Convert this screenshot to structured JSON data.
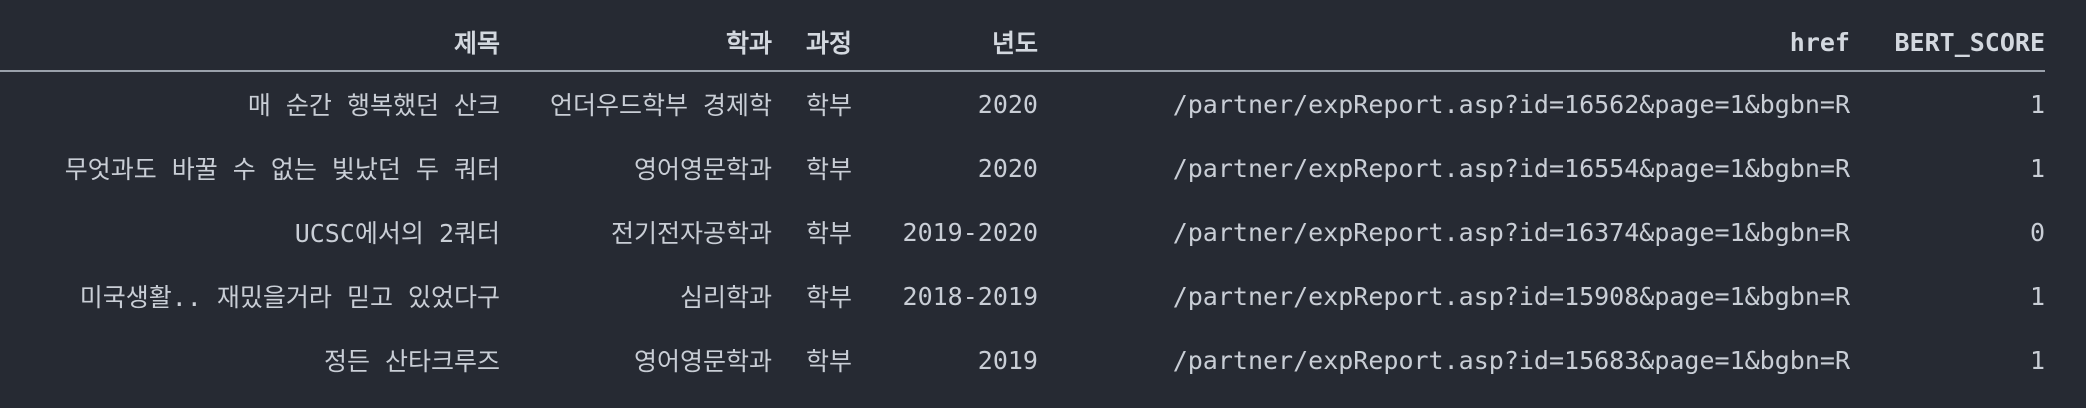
{
  "table": {
    "columns": [
      "제목",
      "학과",
      "과정",
      "년도",
      "href",
      "BERT_SCORE"
    ],
    "rows": [
      [
        "매 순간 행복했던 산크",
        "언더우드학부 경제학",
        "학부",
        "2020",
        "/partner/expReport.asp?id=16562&page=1&bgbn=R",
        "1"
      ],
      [
        "무엇과도 바꿀 수 없는 빛났던 두 쿼터",
        "영어영문학과",
        "학부",
        "2020",
        "/partner/expReport.asp?id=16554&page=1&bgbn=R",
        "1"
      ],
      [
        "UCSC에서의 2쿼터",
        "전기전자공학과",
        "학부",
        "2019-2020",
        "/partner/expReport.asp?id=16374&page=1&bgbn=R",
        "0"
      ],
      [
        "미국생활.. 재밌을거라 믿고 있었다구",
        "심리학과",
        "학부",
        "2018-2019",
        "/partner/expReport.asp?id=15908&page=1&bgbn=R",
        "1"
      ],
      [
        "정든 산타크루즈",
        "영어영문학과",
        "학부",
        "2019",
        "/partner/expReport.asp?id=15683&page=1&bgbn=R",
        "1"
      ]
    ]
  }
}
